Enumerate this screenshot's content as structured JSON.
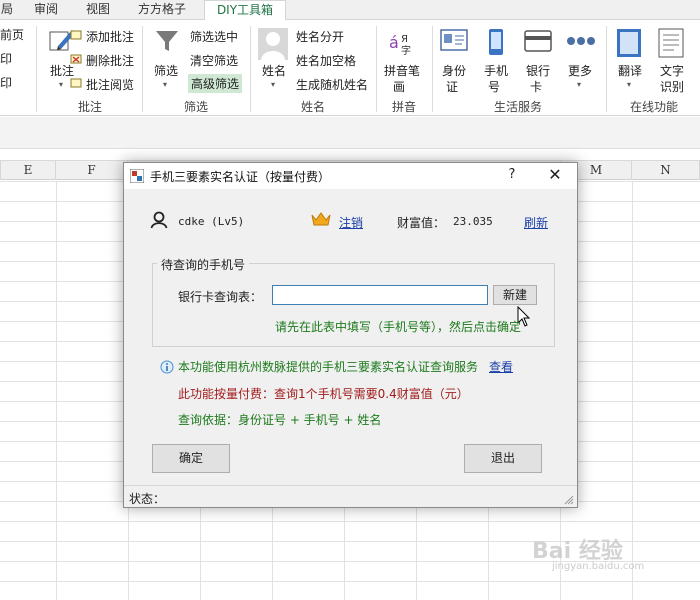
{
  "tabs": [
    "局",
    "审阅",
    "视图",
    "方方格子",
    "DIY工具箱"
  ],
  "active_tab": "DIY工具箱",
  "ribbon": {
    "partial_left": [
      "前页",
      "印",
      "印"
    ],
    "annot_big": "批注",
    "annot_items": [
      "添加批注",
      "删除批注",
      "批注阅览"
    ],
    "annot_group": "批注",
    "filter_big": "筛选",
    "filter_items": [
      "筛选选中",
      "清空筛选",
      "高级筛选"
    ],
    "filter_group": "筛选",
    "name_big": "姓名",
    "name_items": [
      "姓名分开",
      "姓名加空格",
      "生成随机姓名"
    ],
    "name_group": "姓名",
    "pinyin_big": "拼音笔画",
    "pinyin_line1": "拼音笔",
    "pinyin_line2": "画",
    "pinyin_group": "拼音",
    "life_buttons": [
      {
        "line1": "身份",
        "line2": "证"
      },
      {
        "line1": "手机",
        "line2": "号"
      },
      {
        "line1": "银行",
        "line2": "卡"
      },
      {
        "line1": "更多",
        "line2": ""
      }
    ],
    "life_group": "生活服务",
    "translate": "翻译",
    "ocr_line1": "文字",
    "ocr_line2": "识别",
    "online_group": "在线功能"
  },
  "columns": [
    "E",
    "F",
    "M",
    "N"
  ],
  "dialog": {
    "title": "手机三要素实名认证（按量付费）",
    "help": "?",
    "close": "✕",
    "user": "cdke (Lv5)",
    "logout": "注销",
    "wealth_label": "财富值：",
    "wealth_value": "23.035",
    "refresh": "刷新",
    "group_title": "待查询的手机号",
    "bank_label": "银行卡查询表：",
    "bank_value": "",
    "new_button": "新建",
    "hint": "请先在此表中填写（手机号等），然后点击确定",
    "info1": "本功能使用杭州数脉提供的手机三要素实名认证查询服务",
    "info1_link": "查看",
    "info2": "此功能按量付费：查询1个手机号需要0.4财富值（元）",
    "info3": "查询依据：身份证号 + 手机号 + 姓名",
    "ok": "确定",
    "exit": "退出",
    "status": "状态："
  },
  "watermark": {
    "main": "Bai 经验",
    "sub": "jingyan.baidu.com"
  },
  "colors": {
    "accent": "#217346",
    "highlight": "#cfe8d3",
    "link": "#1a3fa8",
    "green_text": "#1c7a1c",
    "red_text": "#a11b1b"
  }
}
